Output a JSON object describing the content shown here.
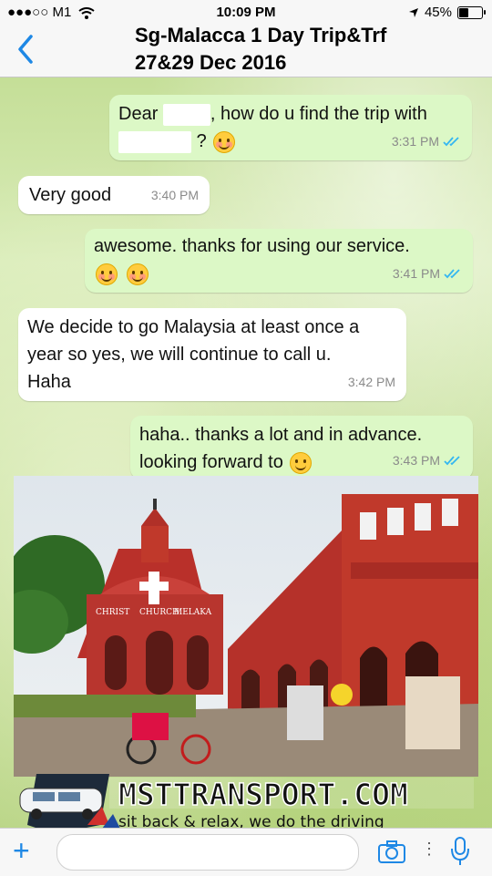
{
  "status_bar": {
    "carrier": "●●●○○ M1",
    "time": "10:09 PM",
    "battery": "45%",
    "battery_level": 0.45
  },
  "header": {
    "title_line1": "Sg-Malacca 1 Day Trip&Trf",
    "title_line2": "27&29 Dec 2016"
  },
  "messages": [
    {
      "direction": "outgoing",
      "text_a": "Dear",
      "text_b": ", how do u find the trip with",
      "text_c": "?",
      "time": "3:31 PM",
      "status": "read"
    },
    {
      "direction": "incoming",
      "text": "Very good",
      "time": "3:40 PM"
    },
    {
      "direction": "outgoing",
      "text": "awesome. thanks for using our service.",
      "time": "3:41 PM",
      "status": "read"
    },
    {
      "direction": "incoming",
      "text_line1": "We decide to go Malaysia at least once a",
      "text_line2": "year so yes, we will continue to call u.",
      "text_line3": "Haha",
      "time": "3:42 PM"
    },
    {
      "direction": "outgoing",
      "text_line1": "haha.. thanks a lot and in advance.",
      "text_line2": "looking forward to",
      "time": "3:43 PM",
      "status": "read"
    }
  ],
  "photo": {
    "sign_1": "CHRIST",
    "sign_2": "CHURCH",
    "sign_3": "MELAKA"
  },
  "banner": {
    "brand": "MSTTRANSPORT.COM",
    "tagline": "sit back & relax, we do the driving"
  },
  "colors": {
    "outgoing_bubble": "#dcf8c6",
    "incoming_bubble": "#ffffff",
    "accent": "#1e88e5",
    "read_ticks": "#34b7f1",
    "church_red": "#c0392b"
  },
  "icons": {
    "back": "chevron-left-icon",
    "location": "location-arrow-icon",
    "wifi": "wifi-icon",
    "add": "plus-icon",
    "camera": "camera-icon",
    "mic": "microphone-icon"
  }
}
